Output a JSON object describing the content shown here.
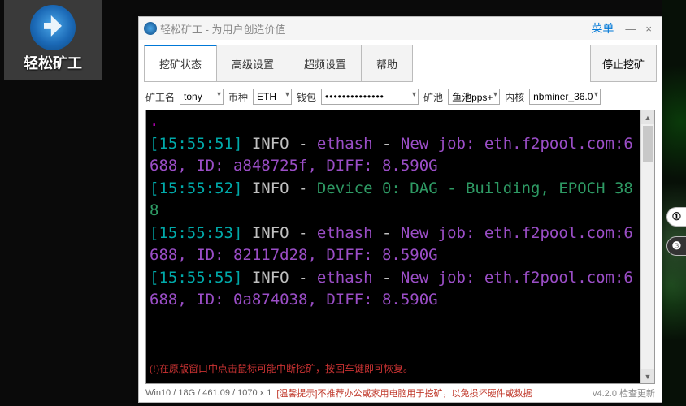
{
  "desktop": {
    "icon_label": "轻松矿工",
    "icon_name": "app-shortcut-icon"
  },
  "titlebar": {
    "title": "轻松矿工 - 为用户创造价值",
    "menu": "菜单",
    "minimize": "—",
    "close": "×"
  },
  "tabs": {
    "mining_status": "挖矿状态",
    "advanced_settings": "高级设置",
    "overclock_settings": "超频设置",
    "help": "帮助",
    "stop_mining": "停止挖矿"
  },
  "form": {
    "miner_label": "矿工名",
    "miner_value": "tony",
    "coin_label": "币种",
    "coin_value": "ETH",
    "wallet_label": "钱包",
    "wallet_value": "••••••••••••••",
    "pool_label": "矿池",
    "pool_value": "鱼池pps+",
    "kernel_label": "内核",
    "kernel_value": "nbminer_36.0"
  },
  "terminal_hint": "(!)在原版窗口中点击鼠标可能中断挖矿，按回车键即可恢复。",
  "terminal_lines": [
    {
      "ts": "[15:55:51]",
      "level": "INFO",
      "kind": "ethash",
      "text": "New job: eth.f2pool.com:6688, ID: a848725f, DIFF: 8.590G"
    },
    {
      "ts": "[15:55:52]",
      "level": "INFO",
      "kind": "dev",
      "text": "Device 0: DAG - Building, EPOCH 388"
    },
    {
      "ts": "[15:55:53]",
      "level": "INFO",
      "kind": "ethash",
      "text": "New job: eth.f2pool.com:6688, ID: 82117d28, DIFF: 8.590G"
    },
    {
      "ts": "[15:55:55]",
      "level": "INFO",
      "kind": "ethash",
      "text": "New job: eth.f2pool.com:6688, ID: 0a874038, DIFF: 8.590G"
    }
  ],
  "status": {
    "sysinfo": "Win10  /  18G / 461.09  / 1070 x 1",
    "warning": "[温馨提示]不推荐办公或家用电脑用于挖矿，以免损坏硬件或数据",
    "version": "v4.2.0 检查更新"
  },
  "float": {
    "a": "①",
    "b": "❸"
  }
}
